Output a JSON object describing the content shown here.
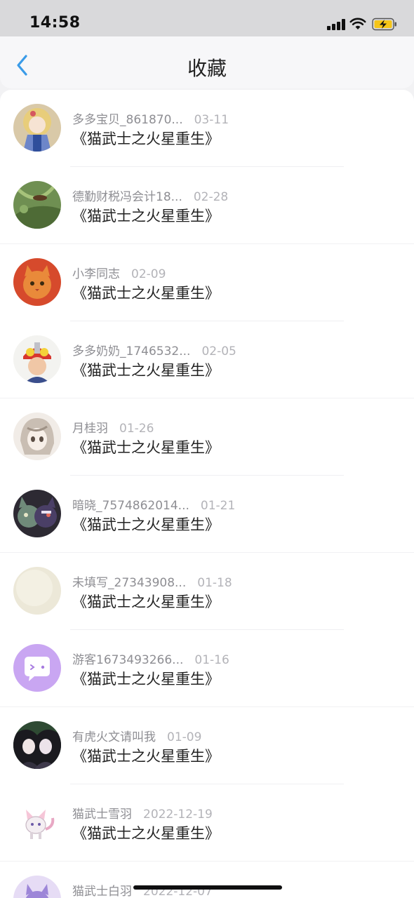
{
  "status_bar": {
    "time": "14:58"
  },
  "nav": {
    "title": "收藏"
  },
  "list": [
    {
      "user": "多多宝贝_861870...",
      "date": "03-11",
      "title": "《猫武士之火星重生》",
      "avatar": "anime-girl-blonde-avatar"
    },
    {
      "user": "德勤财税冯会计18...",
      "date": "02-28",
      "title": "《猫武士之火星重生》",
      "avatar": "nature-leaf-avatar"
    },
    {
      "user": "小李同志",
      "date": "02-09",
      "title": "《猫武士之火星重生》",
      "avatar": "orange-cat-avatar"
    },
    {
      "user": "多多奶奶_1746532...",
      "date": "02-05",
      "title": "《猫武士之火星重生》",
      "avatar": "ultraman-photo-avatar"
    },
    {
      "user": "月桂羽",
      "date": "01-26",
      "title": "《猫武士之火星重生》",
      "avatar": "anime-sketch-girl-avatar"
    },
    {
      "user": "暗晓_7574862014...",
      "date": "01-21",
      "title": "《猫武士之火星重生》",
      "avatar": "two-cartoon-cats-avatar"
    },
    {
      "user": "未填写_27343908...",
      "date": "01-18",
      "title": "《猫武士之火星重生》",
      "avatar": "cream-blank-avatar"
    },
    {
      "user": "游客1673493266...",
      "date": "01-16",
      "title": "《猫武士之火星重生》",
      "avatar": "purple-chat-default-avatar"
    },
    {
      "user": "有虎火文请叫我",
      "date": "01-09",
      "title": "《猫武士之火星重生》",
      "avatar": "dark-anime-pair-avatar"
    },
    {
      "user": "猫武士雪羽",
      "date": "2022-12-19",
      "title": "《猫武士之火星重生》",
      "avatar": "white-pink-cat-avatar"
    },
    {
      "user": "猫武士白羽",
      "date": "2022-12-07",
      "title": "",
      "avatar": "purple-cat-avatar"
    }
  ]
}
